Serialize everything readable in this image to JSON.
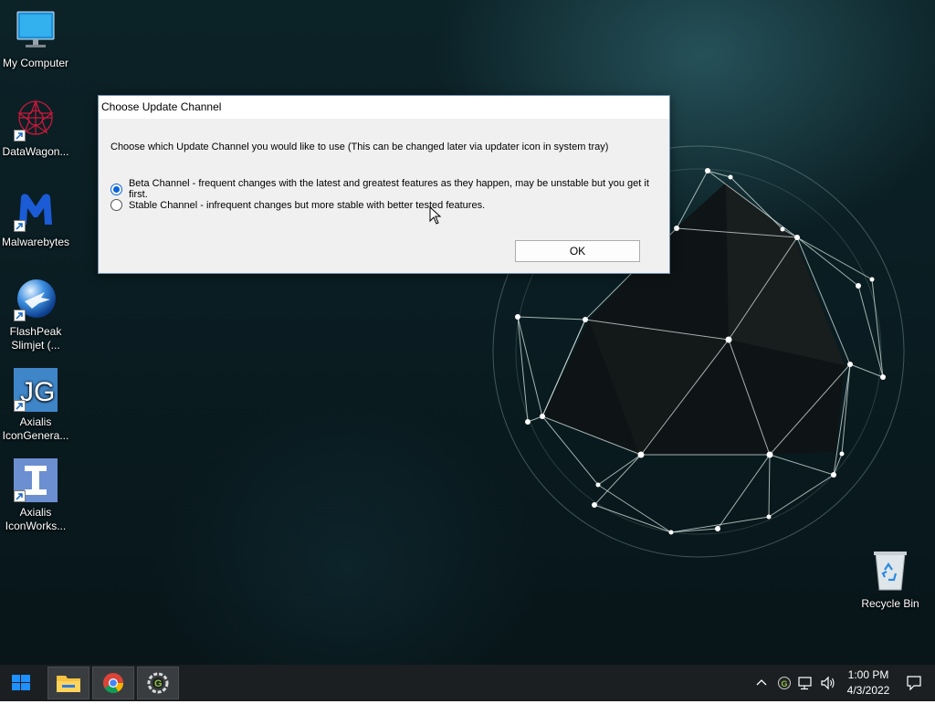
{
  "desktop": {
    "icons": [
      {
        "label": "My Computer",
        "icon": "monitor-icon"
      },
      {
        "label": "DataWagon...",
        "icon": "datawagon-icon"
      },
      {
        "label": "Malwarebytes",
        "icon": "malwarebytes-icon"
      },
      {
        "label": "FlashPeak Slimjet (...",
        "icon": "slimjet-icon"
      },
      {
        "label": "Axialis IconGenera...",
        "icon": "axialis-icongenerator-icon"
      },
      {
        "label": "Axialis IconWorks...",
        "icon": "axialis-iconworkshop-icon"
      },
      {
        "label": "Recycle Bin",
        "icon": "recycle-bin-icon"
      }
    ]
  },
  "dialog": {
    "title": "Choose Update Channel",
    "prompt": "Choose which Update Channel you would like to use (This can be changed later via updater icon in system tray)",
    "options": [
      {
        "label": "Beta Channel - frequent changes with the latest and greatest features as they happen, may be unstable but you get it first.",
        "selected": true
      },
      {
        "label": "Stable Channel - infrequent changes but more stable with better tested features.",
        "selected": false
      }
    ],
    "ok_label": "OK"
  },
  "taskbar": {
    "start_icon": "windows-start-icon",
    "pinned": [
      "file-explorer-icon",
      "chrome-icon",
      "app-gear-icon"
    ],
    "tray": {
      "time": "1:00 PM",
      "date": "4/3/2022",
      "icons": [
        "chevron-up-icon",
        "app-tray-icon",
        "network-icon",
        "volume-icon",
        "notification-icon"
      ]
    }
  },
  "colors": {
    "accent": "#0a64d8",
    "taskbar": "#1b1f22",
    "dialog_bg": "#f0f0f0"
  }
}
